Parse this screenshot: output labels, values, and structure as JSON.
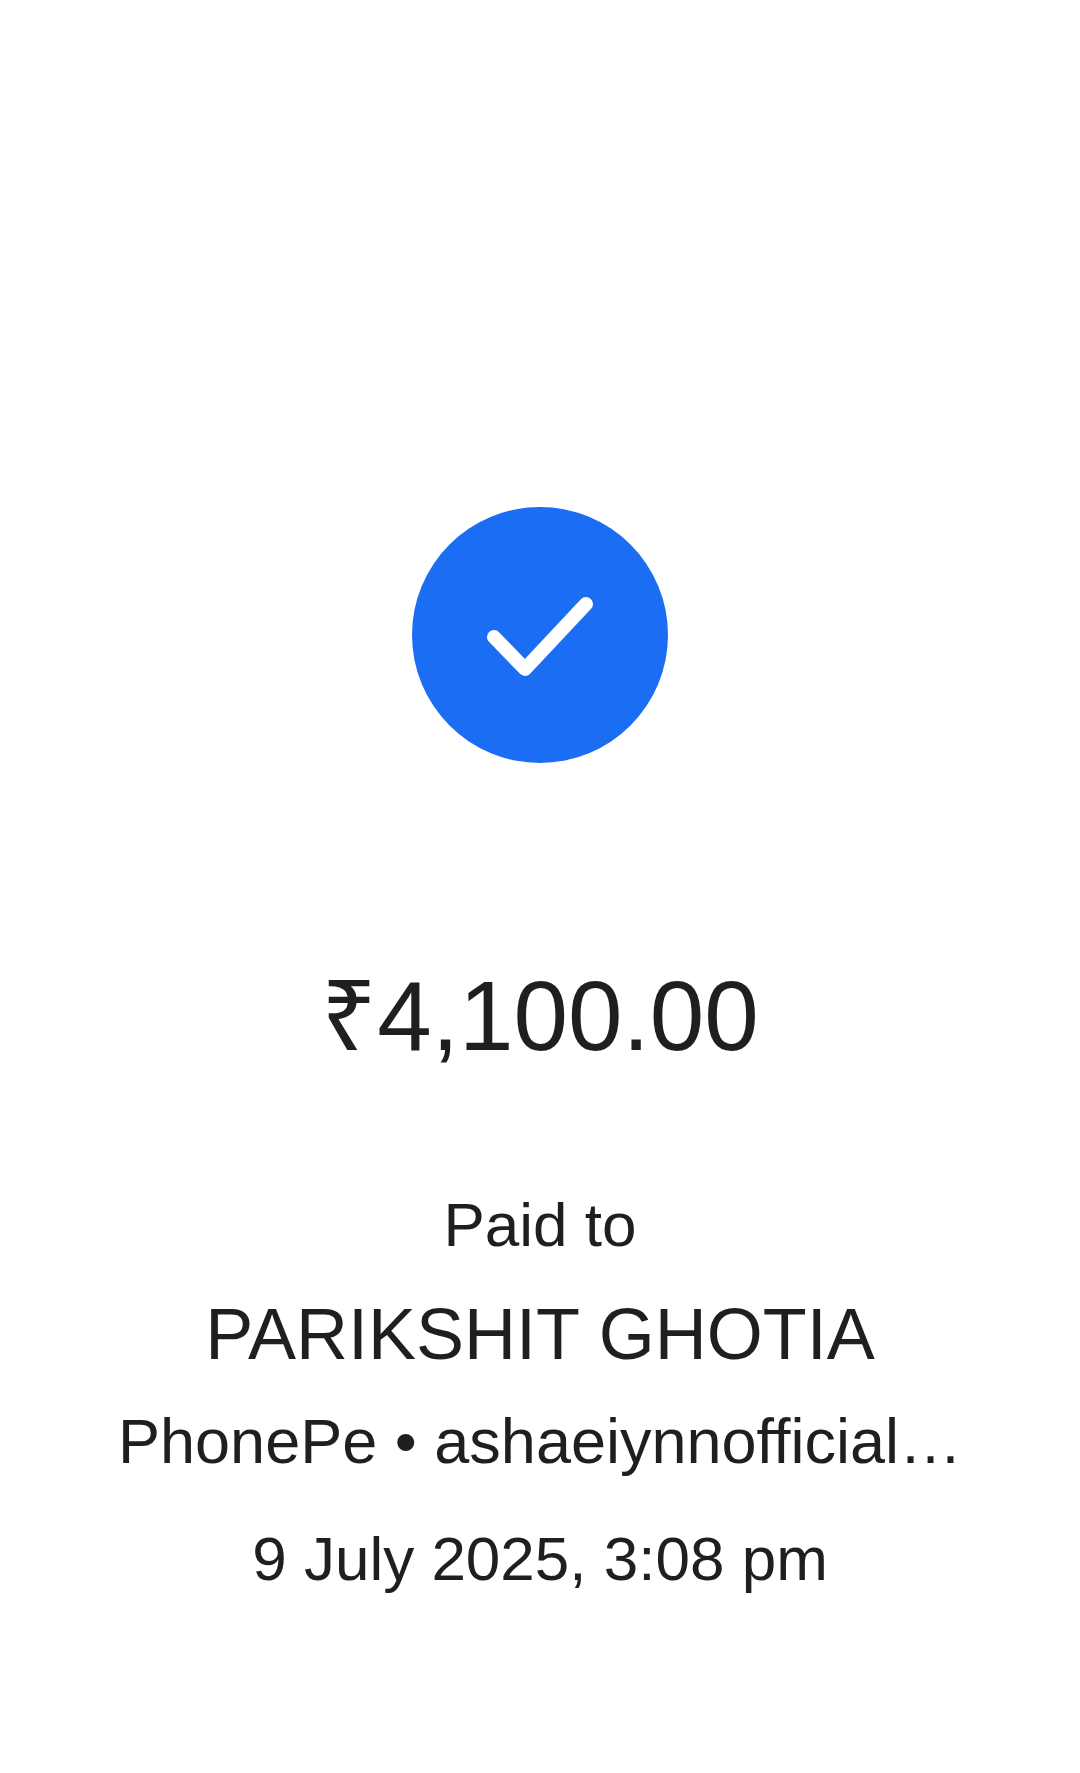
{
  "payment": {
    "amount": "₹4,100.00",
    "label": "Paid to",
    "payee": "PARIKSHIT GHOTIA",
    "payee_details": "PhonePe • ashaeiynnofficial…",
    "date_time": "9 July 2025, 3:08 pm"
  }
}
